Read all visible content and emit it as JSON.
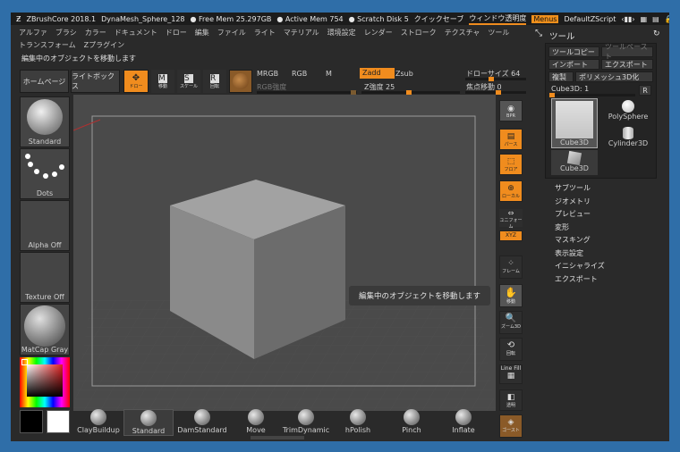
{
  "title_bar": {
    "app": "ZBrushCore 2018.1",
    "file": "DynaMesh_Sphere_128",
    "free_mem": "● Free Mem 25.297GB",
    "active_mem": "● Active Mem 754",
    "scratch": "● Scratch Disk 5",
    "quicksave": "クイックセーブ",
    "transparency": "ウィンドウ透明度",
    "menus": "Menus",
    "script": "DefaultZScript"
  },
  "menu": [
    "アルファ",
    "ブラシ",
    "カラー",
    "ドキュメント",
    "ドロー",
    "編集",
    "ファイル",
    "ライト",
    "マテリアル",
    "環境設定",
    "レンダー",
    "ストローク",
    "テクスチャ",
    "ツール"
  ],
  "menu2": [
    "トランスフォーム",
    "Zプラグイン"
  ],
  "status_text": "編集中のオブジェクトを移動します",
  "toolbar": {
    "home": "ホームページ",
    "lightbox": "ライトボックス",
    "draw": "ドロー",
    "move": "移動",
    "scale": "スケール",
    "rotate": "回転",
    "mrgb": "MRGB",
    "rgb": "RGB",
    "m": "M",
    "zadd": "Zadd",
    "zsub": "Zsub",
    "rgb_intensity": "RGB強度",
    "z_intensity": "Z強度 25",
    "draw_size": "ドローサイズ 64",
    "focal_shift": "焦点移動 0"
  },
  "left_tiles": {
    "standard": "Standard",
    "dots": "Dots",
    "alpha": "Alpha Off",
    "texture": "Texture Off",
    "matcap": "MatCap Gray"
  },
  "right_tools": [
    "BPR",
    "パース",
    "フロア",
    "ローカル",
    "ユニフォーム",
    "XYZ",
    "フレーム",
    "移動",
    "ズーム3D",
    "回転",
    "Line Fill",
    "透明",
    "ゴースト"
  ],
  "tool_panel": {
    "title": "ツール",
    "copy": "ツールコピー",
    "paste": "ツールペースト",
    "import": "インポート",
    "export": "エクスポート",
    "clone": "複製",
    "polymesh": "ポリメッシュ3D化",
    "current": "Cube3D: 1",
    "r": "R",
    "items": [
      "Cube3D",
      "PolySphere",
      "Cylinder3D",
      "Cube3D"
    ]
  },
  "subpanels": [
    "サブツール",
    "ジオメトリ",
    "プレビュー",
    "変形",
    "マスキング",
    "表示設定",
    "イニシャライズ",
    "エクスポート"
  ],
  "tooltip": "編集中のオブジェクトを移動します",
  "brushes": [
    "ClayBuildup",
    "Standard",
    "DamStandard",
    "Move",
    "TrimDynamic",
    "hPolish",
    "Pinch",
    "Inflate"
  ],
  "colors": {
    "accent": "#f08c1e",
    "bg": "#2a2a2a",
    "canvas": "#4a4a4a"
  }
}
